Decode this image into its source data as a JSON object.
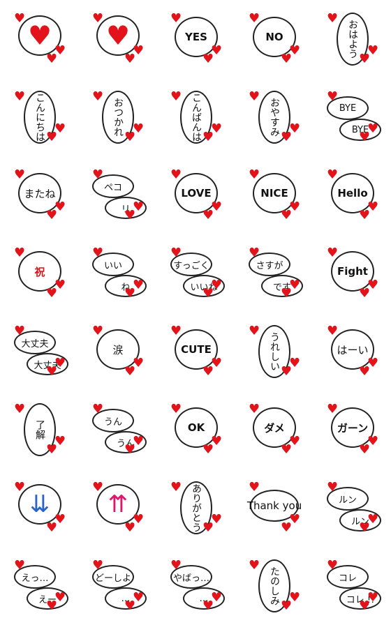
{
  "colors": {
    "heart": "#e3131b",
    "outline": "#222222",
    "tear": "#3a8fe0"
  },
  "stickers": [
    {
      "icon": "heart",
      "labels": []
    },
    {
      "icon": "broken-heart",
      "labels": []
    },
    {
      "labels": [
        "YES"
      ],
      "style": "bold"
    },
    {
      "labels": [
        "NO"
      ],
      "style": "bold"
    },
    {
      "labels": [
        "おはよう"
      ],
      "style": "vert"
    },
    {
      "labels": [
        "こんにちは"
      ],
      "style": "vert"
    },
    {
      "labels": [
        "おつかれ"
      ],
      "style": "vert"
    },
    {
      "labels": [
        "こんばんは"
      ],
      "style": "vert"
    },
    {
      "labels": [
        "おやすみ"
      ],
      "style": "vert"
    },
    {
      "labels": [
        "BYE",
        "BYE"
      ]
    },
    {
      "labels": [
        "またね"
      ]
    },
    {
      "labels": [
        "ペコ",
        "リ"
      ]
    },
    {
      "labels": [
        "LOVE"
      ],
      "style": "bold"
    },
    {
      "labels": [
        "NICE"
      ],
      "style": "bold"
    },
    {
      "labels": [
        "Hello"
      ],
      "style": "bold"
    },
    {
      "labels": [
        "祝"
      ],
      "style": "red"
    },
    {
      "labels": [
        "いい",
        "ね"
      ]
    },
    {
      "labels": [
        "すっごく",
        "いいね"
      ]
    },
    {
      "labels": [
        "さすが",
        "です"
      ]
    },
    {
      "labels": [
        "Fight"
      ],
      "style": "bold"
    },
    {
      "labels": [
        "大丈夫",
        "大丈夫"
      ]
    },
    {
      "labels": [
        "涙"
      ]
    },
    {
      "labels": [
        "CUTE"
      ],
      "style": "bold"
    },
    {
      "labels": [
        "うれしい"
      ],
      "style": "vert"
    },
    {
      "labels": [
        "はーい"
      ]
    },
    {
      "labels": [
        "了解"
      ],
      "style": "vert"
    },
    {
      "labels": [
        "うん",
        "うん"
      ]
    },
    {
      "labels": [
        "OK"
      ],
      "style": "bold"
    },
    {
      "labels": [
        "ダメ"
      ],
      "style": "bold"
    },
    {
      "labels": [
        "ガーン"
      ],
      "style": "bold"
    },
    {
      "icon": "arrows-down",
      "labels": []
    },
    {
      "icon": "arrows-up",
      "labels": []
    },
    {
      "labels": [
        "ありがとう"
      ],
      "style": "vert"
    },
    {
      "labels": [
        "Thank you"
      ],
      "style": "wide"
    },
    {
      "labels": [
        "ルン",
        "ルン"
      ]
    },
    {
      "labels": [
        "えっ…",
        "えー"
      ]
    },
    {
      "labels": [
        "どーしよ",
        "…"
      ]
    },
    {
      "labels": [
        "やばっ…",
        "…"
      ]
    },
    {
      "labels": [
        "たのしみ"
      ],
      "style": "vert"
    },
    {
      "labels": [
        "コレ",
        "コレ !!"
      ]
    }
  ]
}
